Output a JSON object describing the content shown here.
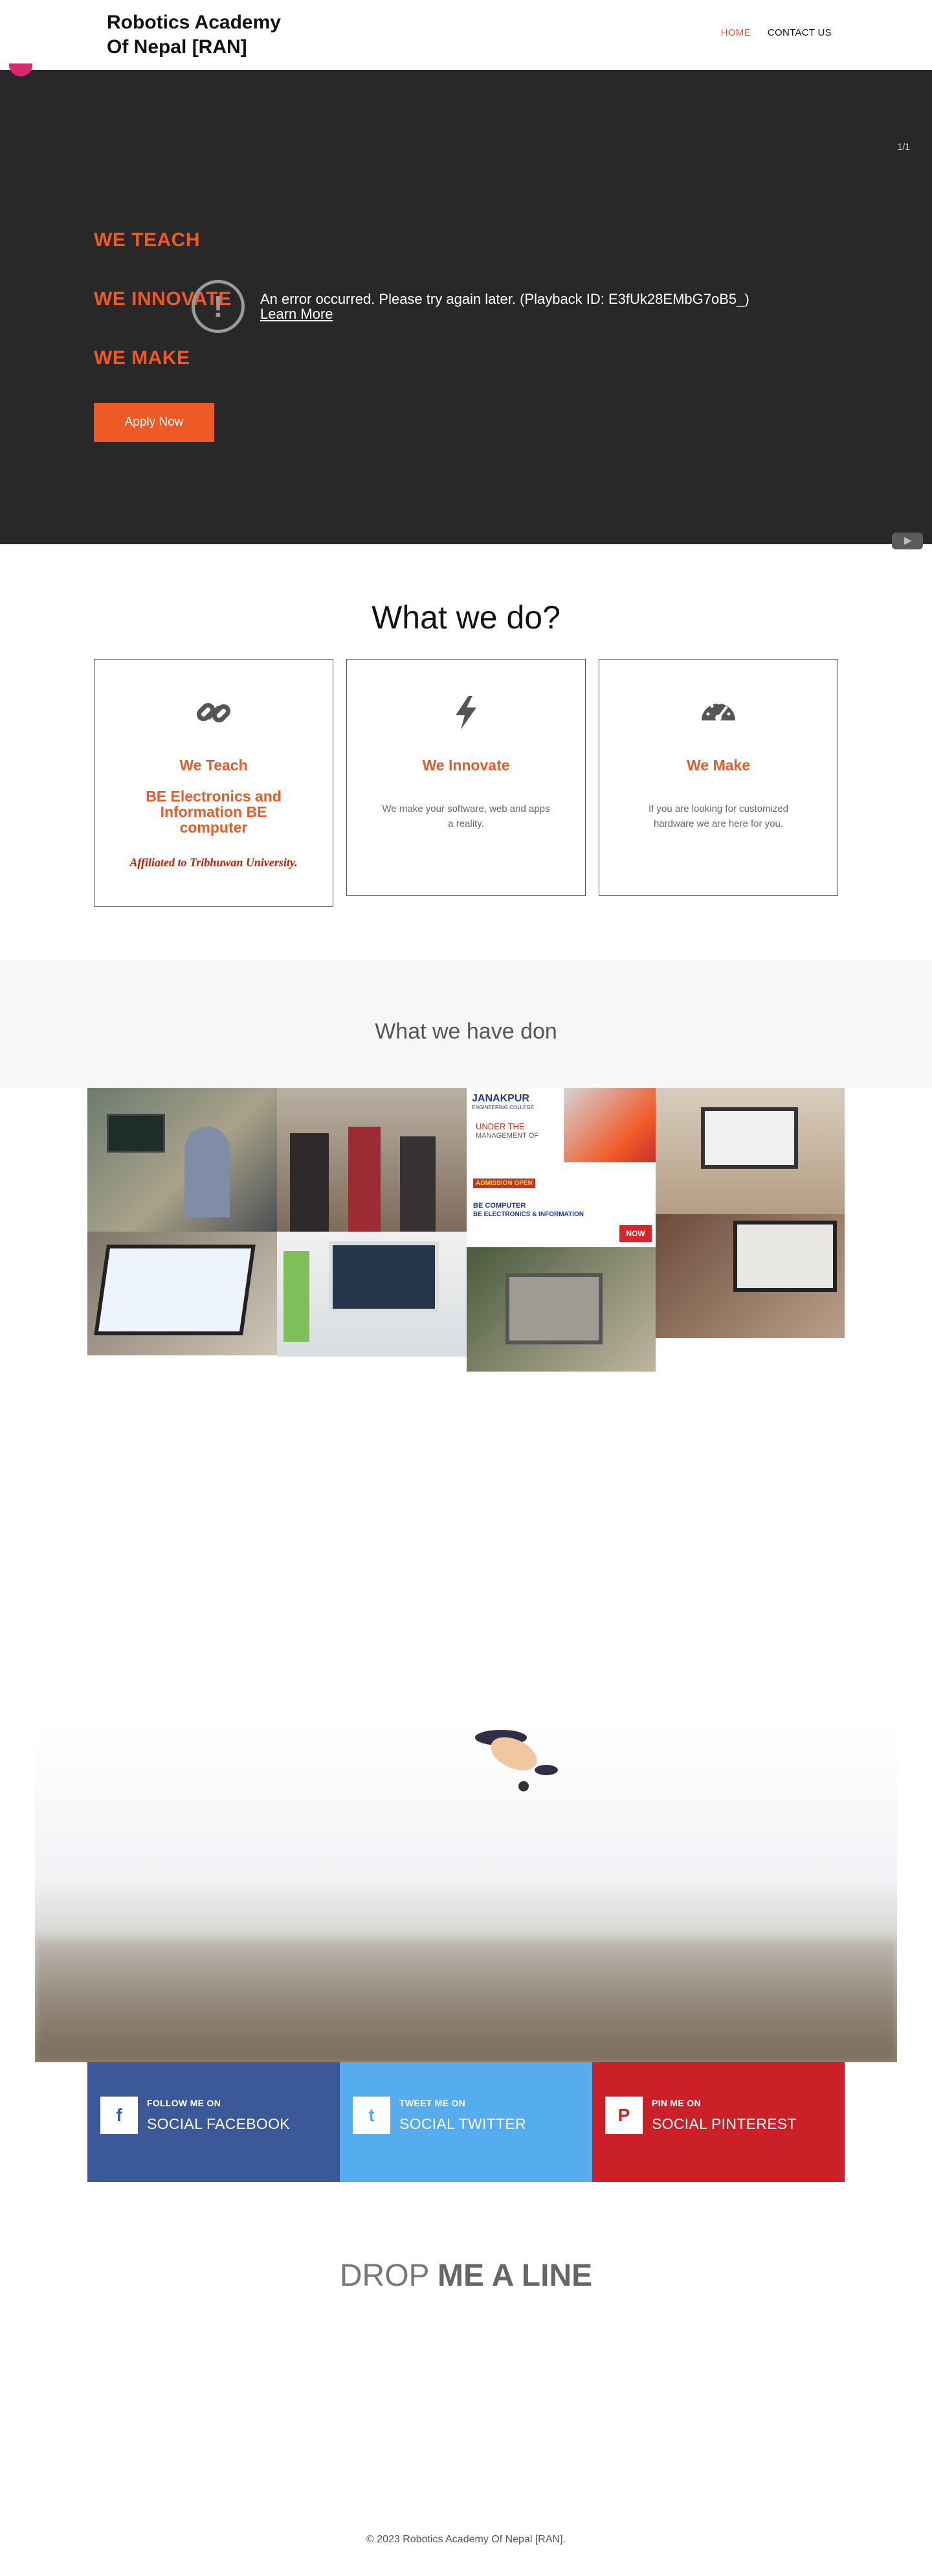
{
  "header": {
    "brand_line1": "Robotics Academy",
    "brand_line2": "Of Nepal [RAN]",
    "nav": [
      {
        "label": "HOME",
        "active": true
      },
      {
        "label": "CONTACT US",
        "active": false
      }
    ]
  },
  "hero": {
    "counter": "1/1",
    "lines": [
      "WE TEACH",
      "WE INNOVATE",
      "WE MAKE"
    ],
    "apply_label": "Apply Now",
    "error_message": "An error occurred. Please try again later. (Playback ID: E3fUk28EMbG7oB5_)",
    "error_link": "Learn More",
    "colors": {
      "accent": "#ef5a24",
      "background": "#282828"
    }
  },
  "what_we_do": {
    "title": "What we do?",
    "cards": [
      {
        "icon": "link-icon",
        "title": "We Teach",
        "subtitle": "BE Electronics and Information BE computer",
        "affiliation": "Affiliated to Tribhuwan University."
      },
      {
        "icon": "bolt-icon",
        "title": "We Innovate",
        "description": "We make your software, web and apps a reality."
      },
      {
        "icon": "dashboard-icon",
        "title": "We Make",
        "description": "If you are looking for customized hardware we are here for you."
      }
    ]
  },
  "portfolio": {
    "title": "What we have don",
    "gallery": {
      "janakpur_name": "JANAKPUR",
      "janakpur_sub": "ENGINEERING COLLEGE",
      "under": "UNDER THE",
      "management": "MANAGEMENT OF",
      "admission": "ADMISSION OPEN",
      "course1": "BE COMPUTER",
      "course2": "BE ELECTRONICS & INFORMATION",
      "enroll": "NOW"
    }
  },
  "social": [
    {
      "icon": "facebook-icon",
      "glyph": "f",
      "small": "FOLLOW ME ON",
      "big": "SOCIAL FACEBOOK",
      "color": "#3b5998"
    },
    {
      "icon": "twitter-icon",
      "glyph": "t",
      "small": "TWEET ME ON",
      "big": "SOCIAL TWITTER",
      "color": "#55acee"
    },
    {
      "icon": "pinterest-icon",
      "glyph": "P",
      "small": "PIN ME ON",
      "big": "SOCIAL PINTEREST",
      "color": "#cb2027"
    }
  ],
  "contact": {
    "drop_light": "DROP",
    "drop_bold": "ME A LINE"
  },
  "footer": {
    "copyright": "© 2023 Robotics Academy Of Nepal [RAN]."
  }
}
